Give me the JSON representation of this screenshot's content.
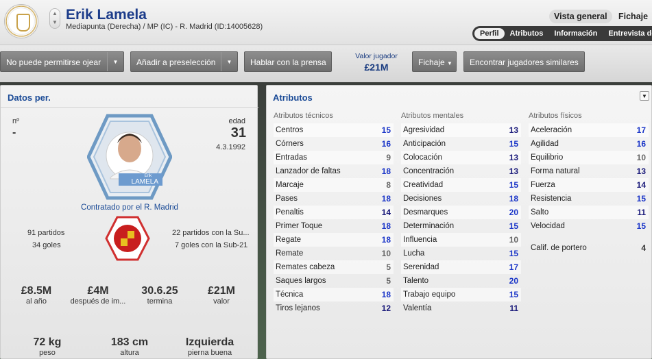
{
  "header": {
    "name": "Erik Lamela",
    "subtitle": "Mediapunta (Derecha) / MP (IC) - R. Madrid (ID:14005628)",
    "nav_vista": "Vista general",
    "nav_fichaje": "Fichaje",
    "tabs": [
      "Perfil",
      "Atributos",
      "Información",
      "Entrevista de"
    ]
  },
  "toolbar": {
    "b1": "No puede permitirse ojear",
    "b2": "Añadir a preselección",
    "b3": "Hablar con la prensa",
    "value_label": "Valor jugador",
    "value": "£21M",
    "b4": "Fichaje",
    "b5": "Encontrar jugadores similares"
  },
  "personal": {
    "title": "Datos per.",
    "num_label": "nº",
    "num_value": "-",
    "age_label": "edad",
    "age": "31",
    "dob": "4.3.1992",
    "card_first": "Erik",
    "card_last": "LAMELA",
    "contract_club": "Contratado por el R. Madrid",
    "caps": "91 partidos",
    "goals": "34 goles",
    "u21_caps": "22 partidos con la Su...",
    "u21_goals": "7 goles con la Sub-21",
    "wage": "£8.5M",
    "wage_label": "al año",
    "after": "£4M",
    "after_label": "después de im...",
    "expires": "30.6.25",
    "expires_label": "termina",
    "val": "£21M",
    "val_label": "valor",
    "weight": "72 kg",
    "weight_label": "peso",
    "height": "183 cm",
    "height_label": "altura",
    "foot": "Izquierda",
    "foot_label": "pierna buena"
  },
  "attributes": {
    "title": "Atributos",
    "technical": {
      "header": "Atributos técnicos",
      "items": [
        [
          "Centros",
          "15"
        ],
        [
          "Córners",
          "16"
        ],
        [
          "Entradas",
          "9"
        ],
        [
          "Lanzador de faltas",
          "18"
        ],
        [
          "Marcaje",
          "8"
        ],
        [
          "Pases",
          "18"
        ],
        [
          "Penaltis",
          "14"
        ],
        [
          "Primer Toque",
          "18"
        ],
        [
          "Regate",
          "18"
        ],
        [
          "Remate",
          "10"
        ],
        [
          "Remates cabeza",
          "5"
        ],
        [
          "Saques largos",
          "5"
        ],
        [
          "Técnica",
          "18"
        ],
        [
          "Tiros lejanos",
          "12"
        ]
      ]
    },
    "mental": {
      "header": "Atributos mentales",
      "items": [
        [
          "Agresividad",
          "13"
        ],
        [
          "Anticipación",
          "15"
        ],
        [
          "Colocación",
          "13"
        ],
        [
          "Concentración",
          "13"
        ],
        [
          "Creatividad",
          "15"
        ],
        [
          "Decisiones",
          "18"
        ],
        [
          "Desmarques",
          "20"
        ],
        [
          "Determinación",
          "15"
        ],
        [
          "Influencia",
          "10"
        ],
        [
          "Lucha",
          "15"
        ],
        [
          "Serenidad",
          "17"
        ],
        [
          "Talento",
          "20"
        ],
        [
          "Trabajo equipo",
          "15"
        ],
        [
          "Valentía",
          "11"
        ]
      ]
    },
    "physical": {
      "header": "Atributos físicos",
      "items": [
        [
          "Aceleración",
          "17"
        ],
        [
          "Agilidad",
          "16"
        ],
        [
          "Equilibrio",
          "10"
        ],
        [
          "Forma natural",
          "13"
        ],
        [
          "Fuerza",
          "14"
        ],
        [
          "Resistencia",
          "15"
        ],
        [
          "Salto",
          "11"
        ],
        [
          "Velocidad",
          "15"
        ]
      ],
      "gk": [
        "Calif. de portero",
        "4"
      ]
    }
  }
}
